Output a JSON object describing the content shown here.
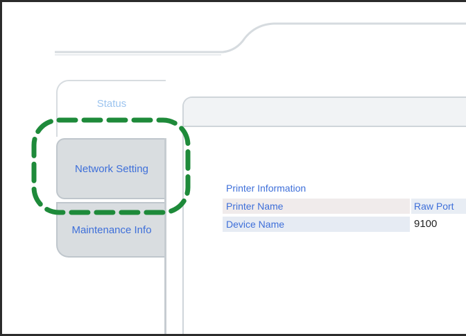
{
  "tabs": {
    "status": "Status",
    "network_setting": "Network Setting",
    "maintenance_info": "Maintenance Info"
  },
  "main": {
    "section_title": "Printer Information",
    "rows": [
      {
        "label": "Printer Name",
        "value": "Raw Port"
      },
      {
        "label": "Device Name",
        "value": "9100"
      }
    ]
  },
  "colors": {
    "link_text": "#3e6fd9",
    "tab_fill": "#d9dde0",
    "callout": "#1e8a3a"
  },
  "highlight": {
    "style": "dashed",
    "target": "Network Setting"
  }
}
